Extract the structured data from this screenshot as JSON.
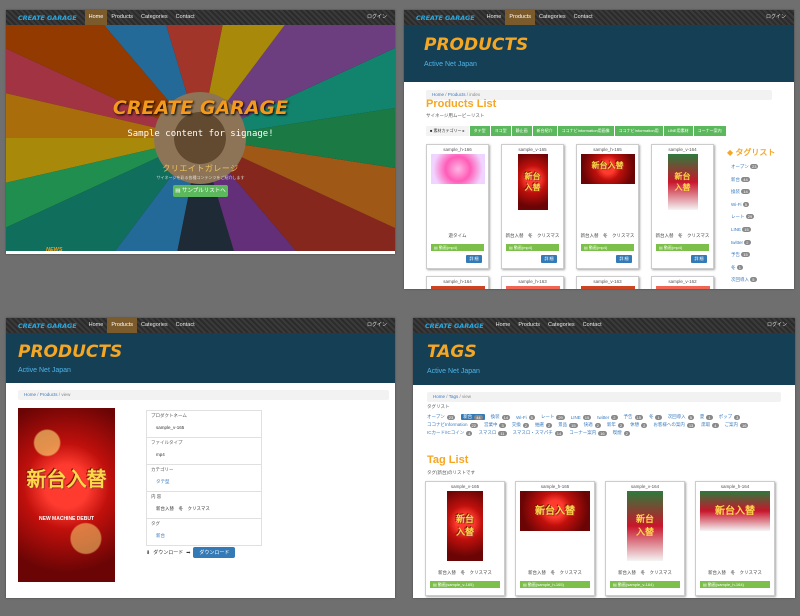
{
  "nav": {
    "brand": "CREATE GARAGE",
    "items": [
      "Home",
      "Products",
      "Categories",
      "Contact"
    ],
    "login": "ログイン"
  },
  "home": {
    "title": "CREATE GARAGE",
    "subtitle": "Sample content for signage!",
    "jp_title": "クリエイトガレージ",
    "jp_desc": "サイネージを彩る各種コンテンツをご紹介します",
    "button": "サンプルリストへ",
    "news": "NEWS"
  },
  "products_list": {
    "header_title": "PRODUCTS",
    "header_sub": "Active Net Japan",
    "breadcrumb": [
      "Home",
      "Products",
      "index"
    ],
    "section_title": "Products List",
    "section_desc": "サイネージ用ムービーリスト",
    "category_label": "素材カテゴリー",
    "categories": [
      "タテ型",
      "ヨコ型",
      "静止画",
      "新台紹介",
      "ココナビInformation用画像",
      "ココナビInformation用",
      "LINE用素材",
      "コーナー案内"
    ],
    "cards": [
      {
        "name": "sample_h-166",
        "desc": "遊タイム",
        "file": "動画(mp4)",
        "detail": "詳 細"
      },
      {
        "name": "sample_v-165",
        "desc": "新台入替　冬　クリスマス",
        "file": "動画(mp4)",
        "detail": "詳 細"
      },
      {
        "name": "sample_h-165",
        "desc": "新台入替　冬　クリスマス",
        "file": "動画(mp4)",
        "detail": "詳 細"
      },
      {
        "name": "sample_v-164",
        "desc": "新台入替　冬　クリスマス",
        "file": "動画(mp4)",
        "detail": "詳 細"
      }
    ],
    "more_cards": [
      "sample_h-164",
      "sample_h-163",
      "sample_v-163",
      "sample_v-162"
    ],
    "taglist_title": "タグリスト",
    "tags": [
      {
        "name": "オープン",
        "count": "23"
      },
      {
        "name": "新台",
        "count": "44"
      },
      {
        "name": "換装",
        "count": "14"
      },
      {
        "name": "Wi-Fi",
        "count": "5"
      },
      {
        "name": "レート",
        "count": "29"
      },
      {
        "name": "LINE",
        "count": "15"
      },
      {
        "name": "twitter",
        "count": "2"
      },
      {
        "name": "予告",
        "count": "15"
      },
      {
        "name": "冬",
        "count": "1"
      },
      {
        "name": "次回導入",
        "count": "5"
      }
    ]
  },
  "product_view": {
    "header_title": "PRODUCTS",
    "header_sub": "Active Net Japan",
    "breadcrumb": [
      "Home",
      "Products",
      "view"
    ],
    "fields": [
      {
        "label": "プロダクトネーム",
        "value": "sample_v-165"
      },
      {
        "label": "ファイルタイプ",
        "value": "mp4"
      },
      {
        "label": "カテゴリー",
        "value": "タテ型"
      },
      {
        "label": "内 容",
        "value": "新台入替　冬　クリスマス"
      },
      {
        "label": "タグ",
        "value": "新台"
      }
    ],
    "download_label": "ダウンロード",
    "download_button": "ダウンロード",
    "image_text": "新台入替",
    "image_sub": "NEW MACHINE DEBUT"
  },
  "tags_page": {
    "header_title": "TAGS",
    "header_sub": "Active Net Japan",
    "breadcrumb": [
      "Home",
      "Tags",
      "view"
    ],
    "list_label": "タグリスト",
    "tags": [
      {
        "name": "オープン",
        "count": "23"
      },
      {
        "name": "新台",
        "count": "44",
        "selected": true
      },
      {
        "name": "換装",
        "count": "14"
      },
      {
        "name": "Wi-Fi",
        "count": "5"
      },
      {
        "name": "レート",
        "count": "29"
      },
      {
        "name": "LINE",
        "count": "15"
      },
      {
        "name": "twitter",
        "count": "2"
      },
      {
        "name": "予告",
        "count": "15"
      },
      {
        "name": "冬",
        "count": "1"
      },
      {
        "name": "次回導入",
        "count": "5"
      },
      {
        "name": "夏",
        "count": "1"
      },
      {
        "name": "ポップ",
        "count": "3"
      },
      {
        "name": "ココナビInformation",
        "count": "22"
      },
      {
        "name": "営業中",
        "count": "3"
      },
      {
        "name": "交換",
        "count": "2"
      },
      {
        "name": "抽選",
        "count": "2"
      },
      {
        "name": "景品",
        "count": "15"
      },
      {
        "name": "快適",
        "count": "2"
      },
      {
        "name": "新年",
        "count": "2"
      },
      {
        "name": "休憩",
        "count": "2"
      },
      {
        "name": "お客様への案内",
        "count": "13"
      },
      {
        "name": "席取",
        "count": "4"
      },
      {
        "name": "ご案内",
        "count": "16"
      },
      {
        "name": "ICカード/ICコイン",
        "count": "4"
      },
      {
        "name": "スマスロ",
        "count": "11"
      },
      {
        "name": "スマスロ・スマパチ",
        "count": "14"
      },
      {
        "name": "コーナー案内",
        "count": "16"
      },
      {
        "name": "喫煙",
        "count": "2"
      }
    ],
    "section_title": "Tag List",
    "section_desc": "タグ(新台)のリストです",
    "cards": [
      {
        "name": "sample_v-165",
        "desc": "新台入替　冬　クリスマス",
        "file": "動画(sample_v-165)"
      },
      {
        "name": "sample_h-165",
        "desc": "新台入替　冬　クリスマス",
        "file": "動画(sample_h-165)"
      },
      {
        "name": "sample_v-164",
        "desc": "新台入替　冬　クリスマス",
        "file": "動画(sample_v-164)"
      },
      {
        "name": "sample_h-164",
        "desc": "新台入替　冬　クリスマス",
        "file": "動画(sample_h-164)"
      }
    ]
  },
  "colors": {
    "accent": "#f5a623",
    "header_bg": "#143f55",
    "nav_active": "#7b5a2c",
    "button_green": "#5cb85c",
    "button_blue": "#337ab7"
  }
}
